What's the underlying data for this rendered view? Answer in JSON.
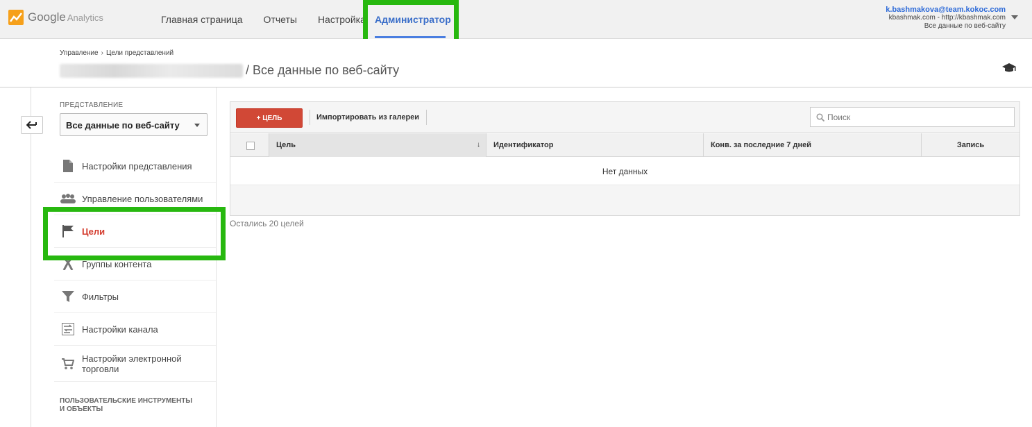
{
  "app": {
    "brand": "Google",
    "product": "Analytics"
  },
  "nav": {
    "home": "Главная страница",
    "reports": "Отчеты",
    "settings": "Настройка",
    "admin": "Администратор"
  },
  "account": {
    "email": "k.bashmakova@team.kokoc.com",
    "property": "kbashmak.com - http://kbashmak.com",
    "view": "Все данные по веб-сайту"
  },
  "breadcrumb": {
    "level1": "Управление",
    "level2": "Цели представлений"
  },
  "page": {
    "title": "/ Все данные по веб-сайту"
  },
  "sidebar": {
    "view_label": "ПРЕДСТАВЛЕНИЕ",
    "view_value": "Все данные по веб-сайту",
    "items": [
      {
        "label": "Настройки представления",
        "icon": "document-icon"
      },
      {
        "label": "Управление пользователями",
        "icon": "users-icon"
      },
      {
        "label": "Цели",
        "icon": "flag-icon"
      },
      {
        "label": "Группы контента",
        "icon": "content-groups-icon"
      },
      {
        "label": "Фильтры",
        "icon": "filter-icon"
      },
      {
        "label": "Настройки канала",
        "icon": "channel-icon"
      },
      {
        "label": "Настройки электронной торговли",
        "icon": "cart-icon"
      }
    ],
    "section_label": "ПОЛЬЗОВАТЕЛЬСКИЕ ИНСТРУМЕНТЫ И ОБЪЕКТЫ"
  },
  "toolbar": {
    "new_goal": "+ ЦЕЛЬ",
    "import": "Импортировать из галереи",
    "search_placeholder": "Поиск"
  },
  "table": {
    "columns": [
      "Цель",
      "Идентификатор",
      "Конв. за последние 7 дней",
      "Запись"
    ],
    "sort_indicator": "↓",
    "empty": "Нет данных"
  },
  "footer": {
    "remaining": "Остались 20 целей"
  },
  "colors": {
    "accent": "#3a6ec9",
    "goal_button": "#d14836",
    "highlight": "#27b80f",
    "active_item": "#d33a2c"
  }
}
